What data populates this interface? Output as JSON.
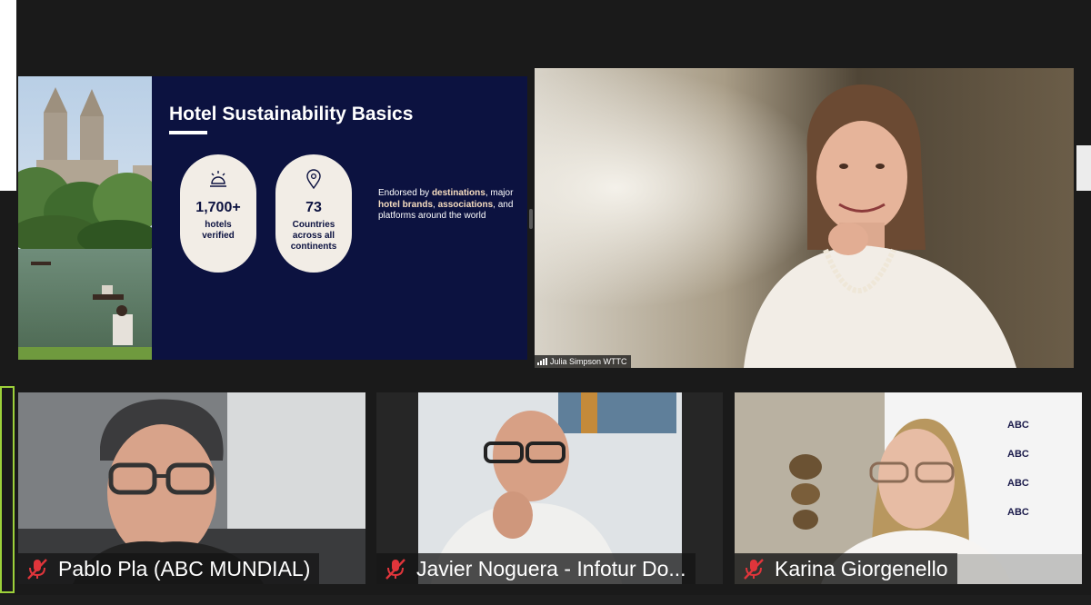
{
  "slide": {
    "title": "Hotel Sustainability Basics",
    "stats": [
      {
        "icon": "hotel-bell-icon",
        "value": "1,700+",
        "label": "hotels verified"
      },
      {
        "icon": "location-pin-icon",
        "value": "73",
        "label": "Countries across all continents"
      }
    ],
    "endorse": {
      "t1": "Endorsed by ",
      "b1": "destinations",
      "t2": ", major ",
      "b2": "hotel brands",
      "t3": ", ",
      "b3": "associations",
      "t4": ", and platforms around the world"
    }
  },
  "speaker": {
    "name": "Julia Simpson WTTC"
  },
  "participants": [
    {
      "name": "Pablo Pla (ABC MUNDIAL)",
      "muted": true
    },
    {
      "name": "Javier Noguera - Infotur Do...",
      "muted": true
    },
    {
      "name": "Karina Giorgenello",
      "muted": true
    }
  ],
  "backdrop": {
    "logo_text": "ABC"
  },
  "colors": {
    "slide_bg": "#0c1240",
    "pill_bg": "#f2ede6",
    "active_border": "#9dd13a",
    "mute_red": "#e0353b"
  }
}
